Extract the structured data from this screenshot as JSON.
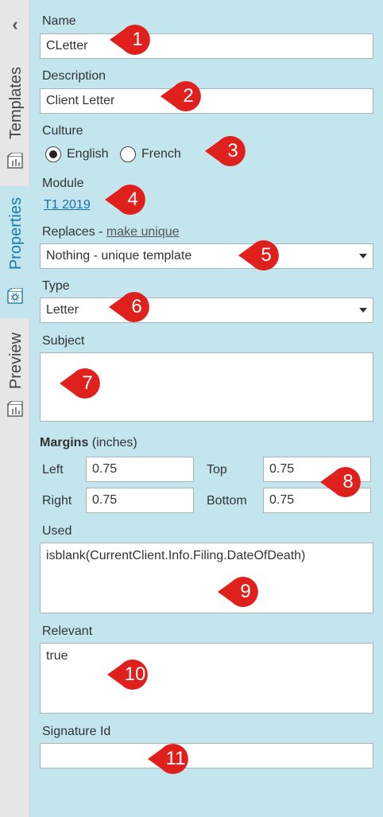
{
  "tabs": [
    {
      "label": "Templates",
      "icon": "template-icon",
      "active": false
    },
    {
      "label": "Properties",
      "icon": "properties-icon",
      "active": true
    },
    {
      "label": "Preview",
      "icon": "preview-icon",
      "active": false
    }
  ],
  "form": {
    "name_label": "Name",
    "name_value": "CLetter",
    "description_label": "Description",
    "description_value": "Client Letter",
    "culture_label": "Culture",
    "culture_options": [
      {
        "label": "English",
        "selected": true
      },
      {
        "label": "French",
        "selected": false
      }
    ],
    "module_label": "Module",
    "module_value": "T1 2019",
    "replaces_label": "Replaces - ",
    "replaces_link": "make unique",
    "replaces_value": "Nothing - unique template",
    "type_label": "Type",
    "type_value": "Letter",
    "subject_label": "Subject",
    "subject_value": "",
    "margins_title": "Margins",
    "margins_unit": " (inches)",
    "margins": {
      "left_label": "Left",
      "left_value": "0.75",
      "right_label": "Right",
      "right_value": "0.75",
      "top_label": "Top",
      "top_value": "0.75",
      "bottom_label": "Bottom",
      "bottom_value": "0.75"
    },
    "used_label": "Used",
    "used_value": "isblank(CurrentClient.Info.Filing.DateOfDeath)",
    "relevant_label": "Relevant",
    "relevant_value": "true",
    "signature_label": "Signature Id",
    "signature_value": ""
  },
  "markers": [
    "1",
    "2",
    "3",
    "4",
    "5",
    "6",
    "7",
    "8",
    "9",
    "10",
    "11"
  ],
  "colors": {
    "panel": "#c2e5ee",
    "marker": "#e0201c",
    "active_tab": "#1a7aa8",
    "link": "#1a6fb0"
  }
}
